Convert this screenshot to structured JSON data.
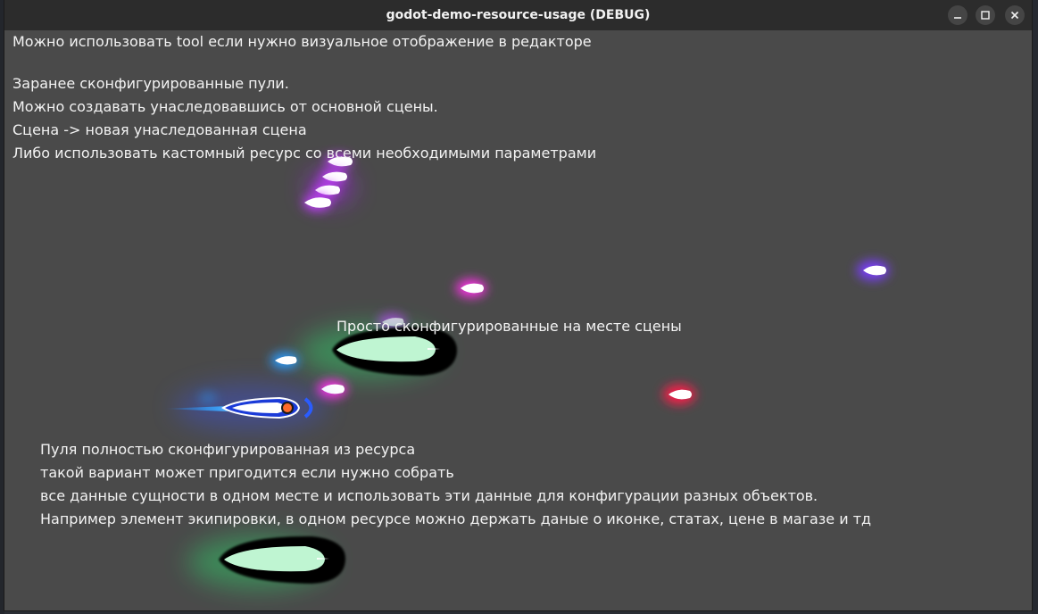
{
  "window": {
    "title": "godot-demo-resource-usage (DEBUG)",
    "minimize_icon": "minimize-icon",
    "maximize_icon": "maximize-icon",
    "close_icon": "close-icon"
  },
  "scene": {
    "tool_note": "Можно использовать tool если нужно визуальное отображение в редакторе",
    "preconfigured_lines": [
      "Заранее сконфигурированные пули.",
      "Можно создавать унаследовавшись от основной сцены.",
      "Сцена -> новая унаследованная сцена",
      "Либо использовать кастомный ресурс со всеми необходимыми параметрами"
    ],
    "inplace_label": "Просто сконфигурированные на месте сцены",
    "resource_lines": [
      "Пуля полностью сконфигурированная из ресурса",
      "такой вариант может пригодится если нужно собрать",
      "все данные сущности в одном месте и использовать эти данные для конфигурации разных объектов.",
      "Например элемент экипировки, в одном ресурсе можно держать даные о иконке, статах, цене в магазе и тд"
    ]
  },
  "colors": {
    "background": "#4a4a4a",
    "titlebar": "#2c2c2c",
    "text": "#f3f3f3",
    "bullet_magenta": "#ff30e8",
    "bullet_purple": "#c020ff",
    "bullet_violet": "#7a3cff",
    "bullet_blue": "#2a9cff",
    "bullet_red": "#ff1a48",
    "bullet_green": "#2fd56a"
  }
}
